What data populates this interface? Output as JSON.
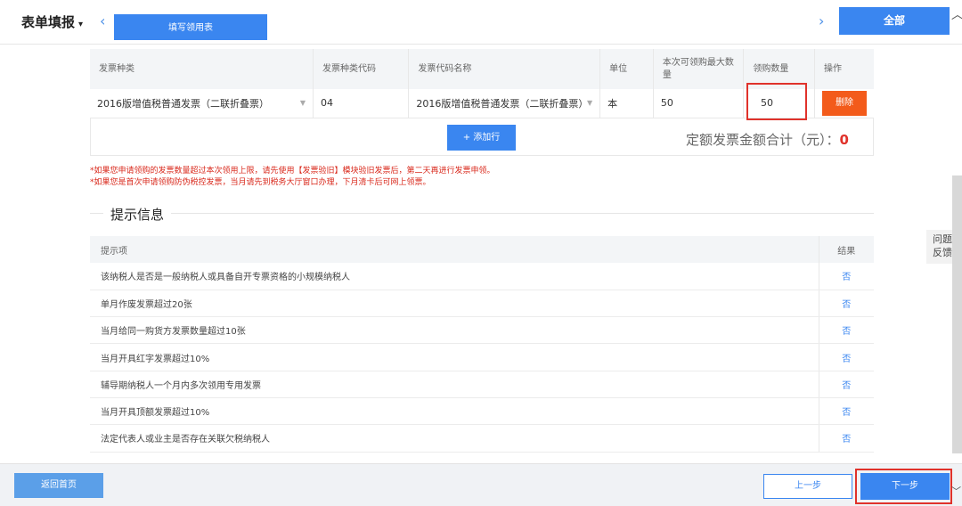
{
  "header": {
    "form_title": "表单填报",
    "caret": "▾",
    "left_arrow": "‹",
    "right_arrow": "›",
    "tab_label": "填写领用表",
    "all_button": "全部",
    "scroll_up": "︿"
  },
  "invoice_table": {
    "columns": [
      "发票种类",
      "发票种类代码",
      "发票代码名称",
      "单位",
      "本次可领购最大数量",
      "领购数量",
      "操作"
    ],
    "rows": [
      {
        "type": "2016版增值税普通发票（二联折叠票）",
        "type_code": "04",
        "code_name": "2016版增值税普通发票（二联折叠票）",
        "unit": "本",
        "max_qty": "50",
        "qty": "50",
        "action": "删除"
      }
    ],
    "add_row_label": "+ 添加行",
    "total_label": "定额发票金额合计（元）：",
    "total_value": "0"
  },
  "notes": [
    "*如果您申请领购的发票数量超过本次领用上限，请先使用【发票验旧】模块验旧发票后，第二天再进行发票申领。",
    "*如果您是首次申请领购防伪税控发票，当月请先到税务大厅窗口办理，下月清卡后可网上领票。"
  ],
  "tips": {
    "section_title": "提示信息",
    "header_item": "提示项",
    "header_result": "结果",
    "rows": [
      {
        "item": "该纳税人是否是一般纳税人或具备自开专票资格的小规模纳税人",
        "result": "否"
      },
      {
        "item": "单月作废发票超过20张",
        "result": "否"
      },
      {
        "item": "当月给同一购货方发票数量超过10张",
        "result": "否"
      },
      {
        "item": "当月开具红字发票超过10%",
        "result": "否"
      },
      {
        "item": "辅导期纳税人一个月内多次领用专用发票",
        "result": "否"
      },
      {
        "item": "当月开具顶额发票超过10%",
        "result": "否"
      },
      {
        "item": "法定代表人或业主是否存在关联欠税纳税人",
        "result": "否"
      }
    ]
  },
  "feedback": {
    "line1": "问题",
    "line2": "反馈"
  },
  "footer": {
    "home_button": "返回首页",
    "prev_button": "上一步",
    "next_button": "下一步",
    "scroll_down": "﹀"
  }
}
